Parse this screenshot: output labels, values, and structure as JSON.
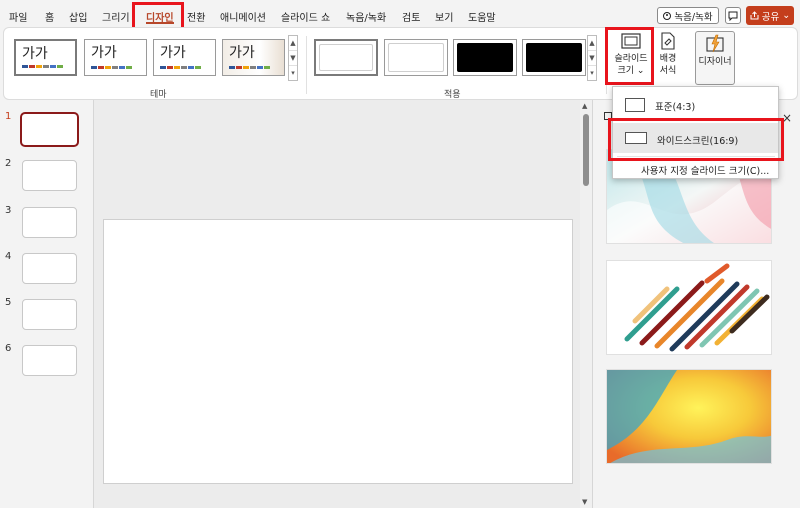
{
  "menu": {
    "tabs": [
      "파일",
      "홈",
      "삽입",
      "그리기",
      "디자인",
      "전환",
      "애니메이션",
      "슬라이드 쇼",
      "녹음/녹화",
      "검토",
      "보기",
      "도움말"
    ],
    "active_tab": "디자인",
    "record_label": "녹음/녹화",
    "share_label": "공유",
    "share_chevron": "⌄"
  },
  "ribbon": {
    "themes": {
      "sample_text": "가가",
      "group_label": "테마",
      "swatch_colors": [
        "#2f5597",
        "#c0392b",
        "#f0a30a",
        "#7f7f7f",
        "#4472c4",
        "#70ad47"
      ]
    },
    "variants": {
      "group_label": "적용",
      "colors": [
        "#ffffff",
        "#ffffff",
        "#000000",
        "#000000"
      ]
    },
    "slide_size": {
      "label_line1": "슬라이드",
      "label_line2": "크기 ⌄"
    },
    "format_background": {
      "label_line1": "배경",
      "label_line2": "서식"
    },
    "designer": {
      "label": "디자이너"
    }
  },
  "slides_panel": {
    "numbers": [
      "1",
      "2",
      "3",
      "4",
      "5",
      "6"
    ],
    "active_index": 0
  },
  "slide_size_menu": {
    "standard": "표준(4:3)",
    "widescreen": "와이드스크린(16:9)",
    "custom": "사용자 지정 슬라이드 크기(C)..."
  },
  "designer_pane": {
    "close_glyph": "×"
  },
  "highlight_color": "#e8141c",
  "accent_color": "#c43e1c"
}
